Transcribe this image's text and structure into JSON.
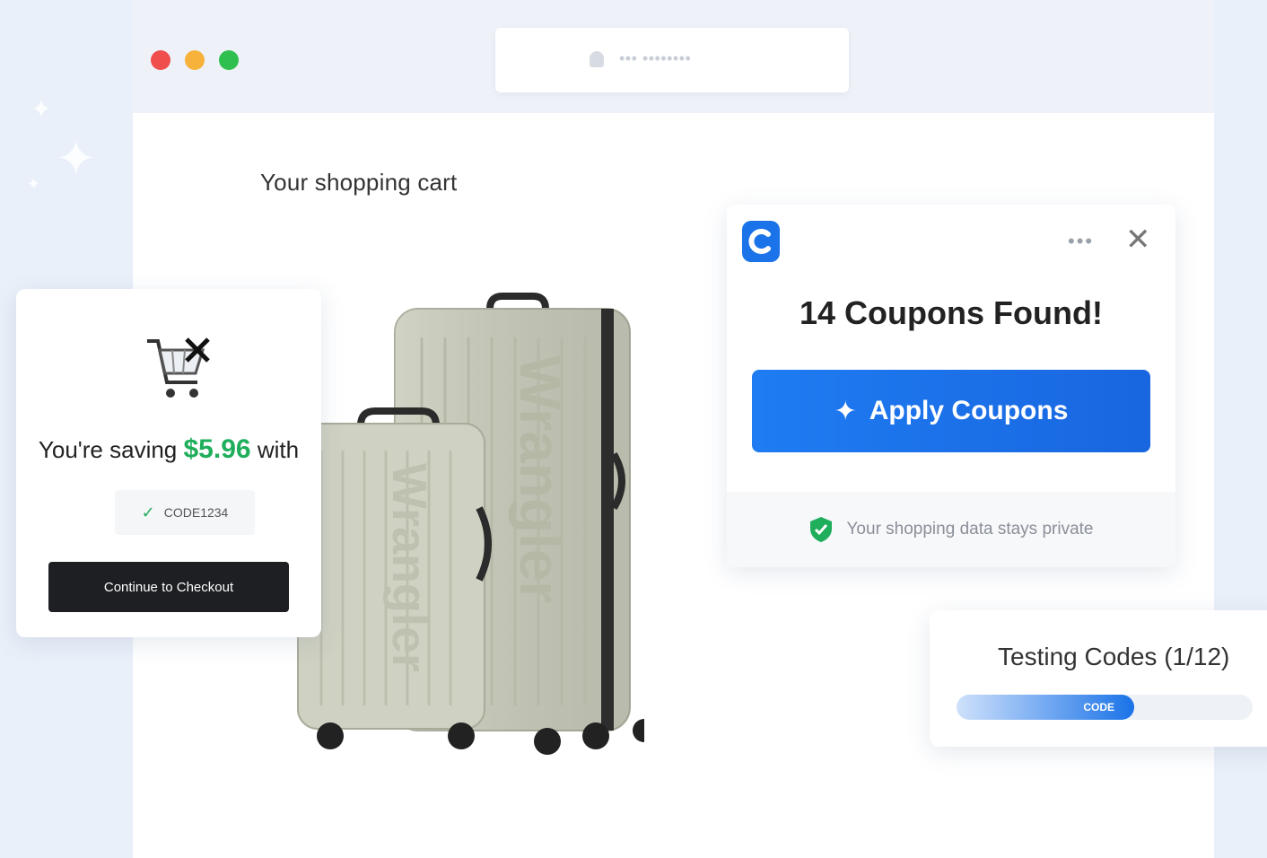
{
  "browser": {
    "url_placeholder": "•••  ••••••••"
  },
  "page": {
    "title": "Your shopping cart",
    "product_brand_text": "Wrangler"
  },
  "coupon_popup": {
    "logo_letter": "C",
    "more_icon": "more-horizontal-icon",
    "close_icon": "close-icon",
    "headline": "14 Coupons Found!",
    "apply_button": "Apply Coupons",
    "privacy_text": "Your shopping data stays private"
  },
  "savings_card": {
    "saving_prefix": "You're saving",
    "saving_amount": "$5.96",
    "saving_suffix": "with",
    "code": "CODE1234",
    "checkout_button": "Continue to Checkout"
  },
  "testing_card": {
    "title": "Testing Codes (1/12)",
    "progress_code": "CODE",
    "progress_fraction": 0.6
  },
  "colors": {
    "accent_blue": "#1a73e8",
    "saving_green": "#1fae5b",
    "dot_red": "#f04d4d",
    "dot_yellow": "#f6b23a",
    "dot_green": "#2fbf4f"
  }
}
